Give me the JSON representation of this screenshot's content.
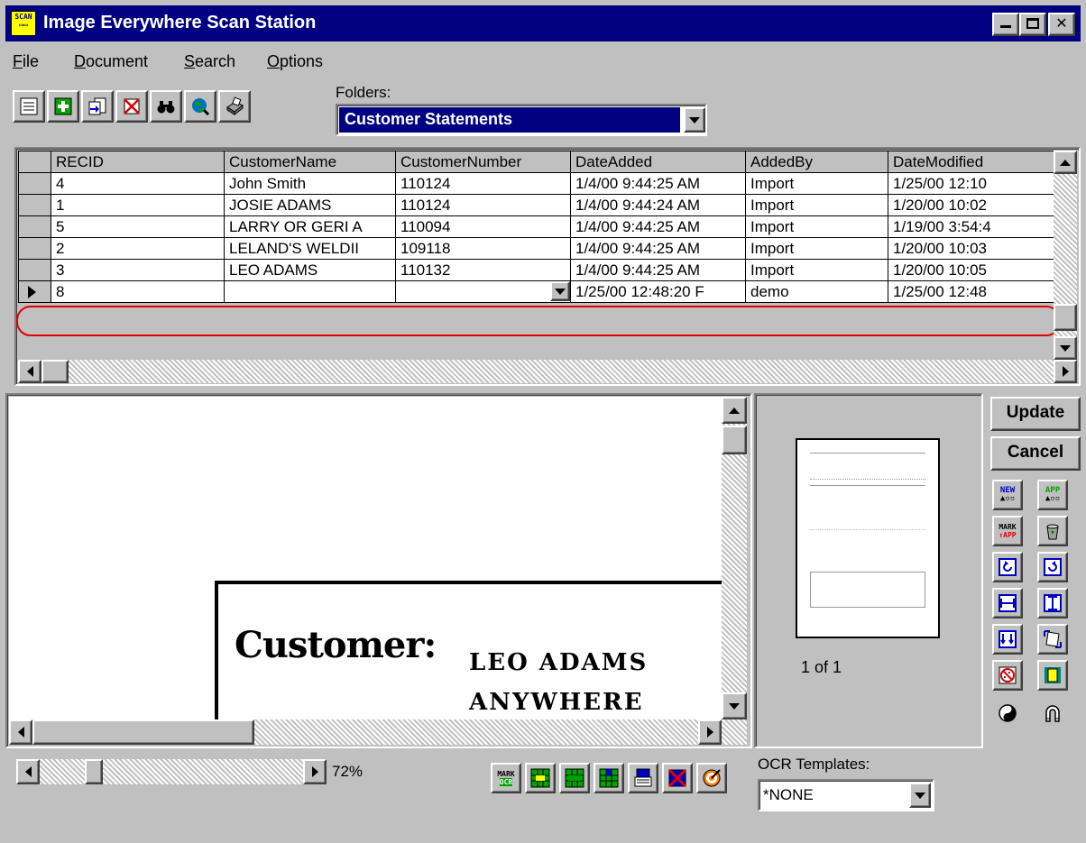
{
  "window": {
    "title": "Image Everywhere Scan Station",
    "icon_text": "SCAN"
  },
  "menu": [
    {
      "label": "File",
      "accel": "F",
      "rest": "ile"
    },
    {
      "label": "Document",
      "accel": "D",
      "rest": "ocument"
    },
    {
      "label": "Search",
      "accel": "S",
      "rest": "earch"
    },
    {
      "label": "Options",
      "accel": "O",
      "rest": "ptions"
    }
  ],
  "toolbar": {
    "buttons": [
      "new-record-icon",
      "add-icon",
      "copy-record-icon",
      "delete-record-icon",
      "binoculars-icon",
      "globe-search-icon",
      "scanner-icon"
    ]
  },
  "folders": {
    "label": "Folders:",
    "selected": "Customer Statements"
  },
  "grid": {
    "columns": [
      "RECID",
      "CustomerName",
      "CustomerNumber",
      "DateAdded",
      "AddedBy",
      "DateModified"
    ],
    "rows": [
      [
        "4",
        "John Smith",
        "110124",
        "1/4/00 9:44:25 AM",
        "Import",
        "1/25/00 12:10"
      ],
      [
        "1",
        "JOSIE ADAMS",
        "110124",
        "1/4/00 9:44:24 AM",
        "Import",
        "1/20/00 10:02"
      ],
      [
        "5",
        "LARRY OR GERI A",
        "110094",
        "1/4/00 9:44:25 AM",
        "Import",
        "1/19/00 3:54:4"
      ],
      [
        "2",
        "LELAND'S WELDII",
        "109118",
        "1/4/00 9:44:25 AM",
        "Import",
        "1/20/00 10:03"
      ],
      [
        "3",
        "LEO ADAMS",
        "110132",
        "1/4/00 9:44:25 AM",
        "Import",
        "1/20/00 10:05"
      ],
      [
        "8",
        "",
        "",
        "1/25/00 12:48:20 F",
        "demo",
        "1/25/00 12:48"
      ]
    ],
    "current_row_index": 5,
    "highlight_color": "#e00000"
  },
  "image": {
    "customer_label": "Customer:",
    "name_line": "LEO ADAMS",
    "city_line": "ANYWHERE"
  },
  "thumbnail": {
    "page_label": "1 of 1"
  },
  "sidebar": {
    "update_label": "Update",
    "cancel_label": "Cancel",
    "new_label": "NEW",
    "app_label": "APP",
    "mark_label": "MARK",
    "mark_app_label": "↑APP"
  },
  "zoom": {
    "value": "72%"
  },
  "ocr": {
    "label": "OCR Templates:",
    "selected": "*NONE",
    "mark_label": "MARK",
    "ocr_label": "OCR"
  },
  "colors": {
    "titlebar": "#000080",
    "selection": "#000080",
    "accent": "#ff0000"
  }
}
